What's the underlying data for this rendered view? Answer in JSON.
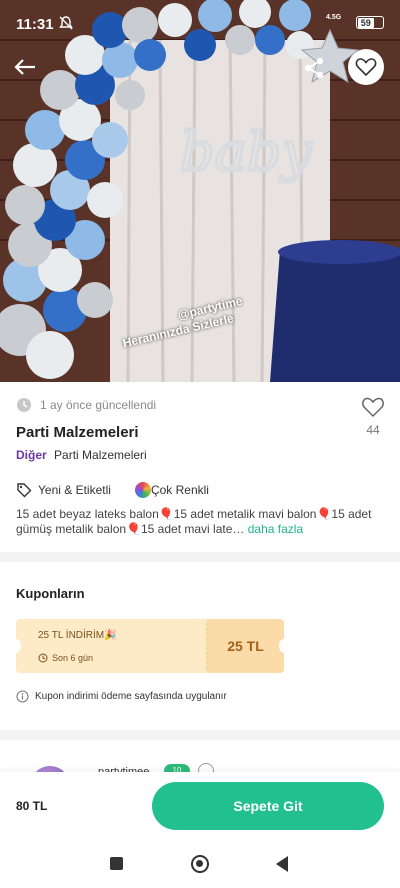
{
  "status_bar": {
    "time": "11:31",
    "network": "4.5G",
    "battery": "59"
  },
  "hero": {
    "watermark_handle": "@partytime",
    "watermark_caption": "Heranınızda Sizlerle",
    "balloon_word": "baby"
  },
  "listing": {
    "updated": "1 ay önce güncellendi",
    "like_count": "44",
    "title": "Parti Malzemeleri",
    "category": "Diğer",
    "subcategory": "Parti Malzemeleri",
    "condition": "Yeni & Etiketli",
    "color": "Çok Renkli",
    "description": "15 adet beyaz lateks balon🎈15 adet metalik mavi balon🎈15 adet gümüş metalik balon🎈15 adet mavi late…",
    "more_label": "daha fazla"
  },
  "coupons": {
    "title": "Kuponların",
    "coupon_name": "25 TL İNDİRİM🎉",
    "coupon_expiry": "Son 6 gün",
    "coupon_value": "25 TL",
    "note": "Kupon indirimi ödeme sayfasında uygulanır"
  },
  "seller": {
    "name": "partytimee",
    "badge": "10"
  },
  "action_bar": {
    "price": "80 TL",
    "cart_button": "Sepete Git"
  },
  "colors": {
    "accent_green": "#22c08e",
    "category_purple": "#6b3aa6",
    "coupon_bg": "#fdebc8",
    "link_green": "#1fb58a"
  },
  "icons": [
    "back-arrow-icon",
    "share-icon",
    "heart-icon",
    "clock-icon",
    "tag-icon",
    "color-palette-icon",
    "info-icon",
    "bell-off-icon"
  ]
}
